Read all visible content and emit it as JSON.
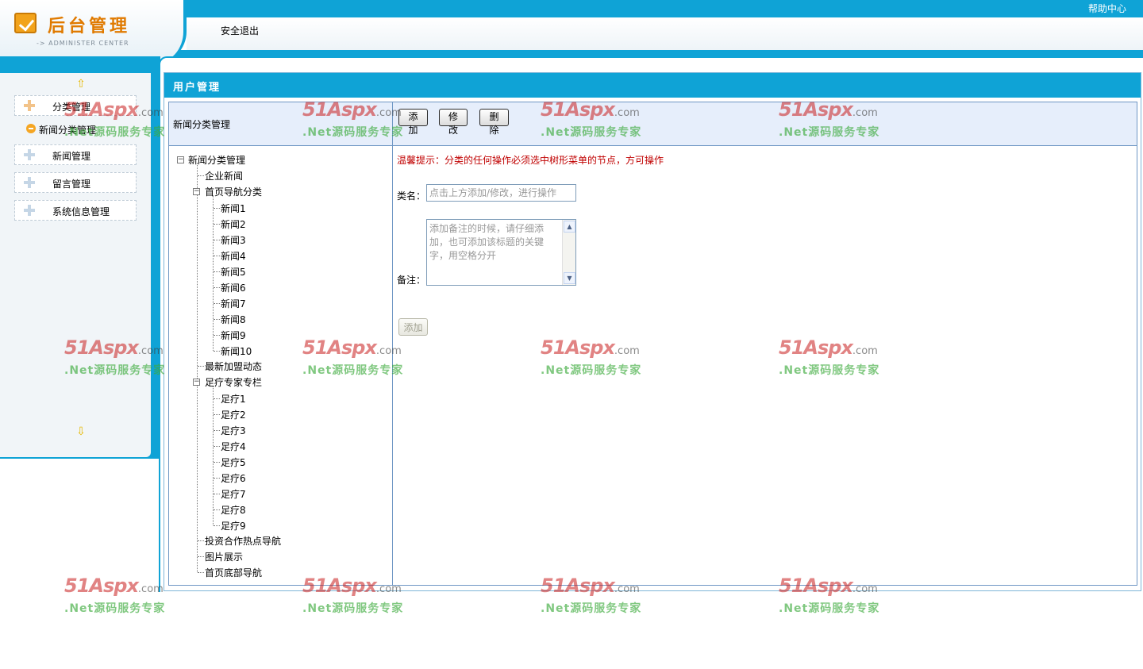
{
  "header": {
    "logo_title": "后台管理",
    "logo_subtitle": "-> ADMINISTER CENTER",
    "logout_label": "安全退出",
    "help_label": "帮助中心"
  },
  "sidebar": {
    "items": [
      {
        "label": "分类管理",
        "active": true
      },
      {
        "label": "新闻管理"
      },
      {
        "label": "留言管理"
      },
      {
        "label": "系统信息管理"
      }
    ],
    "sub_item": "新闻分类管理"
  },
  "main": {
    "title": "用户管理",
    "panel_label": "新闻分类管理",
    "buttons": {
      "add": "添加",
      "edit": "修改",
      "delete": "删除"
    }
  },
  "tree": {
    "root": "新闻分类管理",
    "n1": "企业新闻",
    "n2": "首页导航分类",
    "n2_children": [
      "新闻1",
      "新闻2",
      "新闻3",
      "新闻4",
      "新闻5",
      "新闻6",
      "新闻7",
      "新闻8",
      "新闻9",
      "新闻10"
    ],
    "n3": "最新加盟动态",
    "n4": "足疗专家专栏",
    "n4_children": [
      "足疗1",
      "足疗2",
      "足疗3",
      "足疗4",
      "足疗5",
      "足疗6",
      "足疗7",
      "足疗8",
      "足疗9"
    ],
    "n5": "投资合作热点导航",
    "n6": "图片展示",
    "n7": "首页底部导航"
  },
  "form": {
    "tip": "温馨提示：分类的任何操作必须选中树形菜单的节点，方可操作",
    "name_label": "类名：",
    "name_placeholder": "点击上方添加/修改，进行操作",
    "note_label": "备注：",
    "note_placeholder": "添加备注的时候，请仔细添加，也可添加该标题的关键字，用空格分开",
    "submit_label": "添加"
  },
  "watermark": {
    "brand": "51Aspx",
    "domain": ".com",
    "slogan": ".Net源码服务专家"
  }
}
